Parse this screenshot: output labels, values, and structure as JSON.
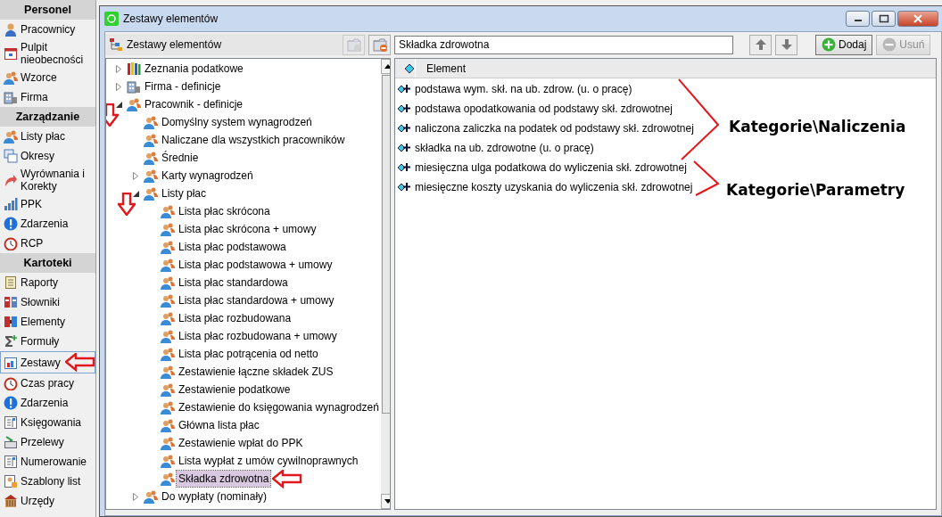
{
  "sidebar": {
    "sections": [
      {
        "title": "Personel",
        "items": [
          {
            "label": "Pracownicy",
            "selected": false
          },
          {
            "label": "Pulpit nieobecności",
            "selected": false
          },
          {
            "label": "Wzorce",
            "selected": false
          },
          {
            "label": "Firma",
            "selected": false
          }
        ]
      },
      {
        "title": "Zarządzanie",
        "items": [
          {
            "label": "Listy płac",
            "selected": false
          },
          {
            "label": "Okresy",
            "selected": false
          },
          {
            "label": "Wyrównania i Korekty",
            "selected": false
          },
          {
            "label": "PPK",
            "selected": false
          },
          {
            "label": "Zdarzenia",
            "selected": false
          },
          {
            "label": "RCP",
            "selected": false
          }
        ]
      },
      {
        "title": "Kartoteki",
        "items": [
          {
            "label": "Raporty",
            "selected": false
          },
          {
            "label": "Słowniki",
            "selected": false
          },
          {
            "label": "Elementy",
            "selected": false
          },
          {
            "label": "Formuły",
            "selected": false
          },
          {
            "label": "Zestawy",
            "selected": true,
            "arrow": true
          },
          {
            "label": "Czas pracy",
            "selected": false
          },
          {
            "label": "Zdarzenia",
            "selected": false
          },
          {
            "label": "Księgowania",
            "selected": false
          },
          {
            "label": "Przelewy",
            "selected": false
          },
          {
            "label": "Numerowanie",
            "selected": false
          },
          {
            "label": "Szablony list",
            "selected": false
          },
          {
            "label": "Urzędy",
            "selected": false
          }
        ]
      }
    ]
  },
  "window": {
    "title": "Zestawy elementów"
  },
  "tree": {
    "title": "Zestawy elementów",
    "items": [
      {
        "label": "Zeznania podatkowe",
        "kind": "books",
        "expanded": false,
        "selected": false
      },
      {
        "label": "Firma - definicje",
        "kind": "building",
        "expanded": false,
        "selected": false
      },
      {
        "label": "Pracownik - definicje",
        "kind": "people",
        "expanded": true,
        "selected": false,
        "arrow": true,
        "children": [
          {
            "label": "Domyślny system wynagrodzeń",
            "kind": "people",
            "selected": false
          },
          {
            "label": "Naliczane dla wszystkich pracowników",
            "kind": "people",
            "selected": false
          },
          {
            "label": "Średnie",
            "kind": "people",
            "selected": false
          },
          {
            "label": "Karty wynagrodzeń",
            "kind": "people",
            "expanded": false,
            "selected": false
          },
          {
            "label": "Listy płac",
            "kind": "people",
            "expanded": true,
            "selected": false,
            "arrow": true,
            "children": [
              {
                "label": "Lista płac skrócona",
                "kind": "people",
                "selected": false
              },
              {
                "label": "Lista płac skrócona + umowy",
                "kind": "people",
                "selected": false
              },
              {
                "label": "Lista płac podstawowa",
                "kind": "people",
                "selected": false
              },
              {
                "label": "Lista płac podstawowa + umowy",
                "kind": "people",
                "selected": false
              },
              {
                "label": "Lista płac standardowa",
                "kind": "people",
                "selected": false
              },
              {
                "label": "Lista płac standardowa + umowy",
                "kind": "people",
                "selected": false
              },
              {
                "label": "Lista płac rozbudowana",
                "kind": "people",
                "selected": false
              },
              {
                "label": "Lista płac rozbudowana + umowy",
                "kind": "people",
                "selected": false
              },
              {
                "label": "Lista płac potrącenia od netto",
                "kind": "people",
                "selected": false
              },
              {
                "label": "Zestawienie łączne składek ZUS",
                "kind": "people",
                "selected": false
              },
              {
                "label": "Zestawienie podatkowe",
                "kind": "people",
                "selected": false
              },
              {
                "label": "Zestawienie do księgowania wynagrodzeń",
                "kind": "people",
                "selected": false
              },
              {
                "label": "Główna lista płac",
                "kind": "people",
                "selected": false
              },
              {
                "label": "Zestawienie wpłat do PPK",
                "kind": "people",
                "selected": false
              },
              {
                "label": "Lista wypłat z umów cywilnoprawnych",
                "kind": "people",
                "selected": false
              },
              {
                "label": "Składka zdrowotna",
                "kind": "people",
                "selected": true,
                "arrow": true
              }
            ]
          },
          {
            "label": "Do wypłaty (nominały)",
            "kind": "people",
            "expanded": false,
            "selected": false
          }
        ]
      }
    ]
  },
  "editor": {
    "name_value": "Składka zdrowotna",
    "buttons": [
      {
        "label": "Dodaj",
        "disabled": false
      },
      {
        "label": "Usuń",
        "disabled": true
      }
    ],
    "column": "Element",
    "rows": [
      "podstawa wym. skł. na ub. zdrow. (u. o pracę)",
      "podstawa opodatkowania od podstawy skł. zdrowotnej",
      "naliczona zaliczka na podatek od podstawy skł. zdrowotnej",
      "składka na ub. zdrowotne (u. o pracę)",
      "miesięczna ulga podatkowa do wyliczenia skł. zdrowotnej",
      "miesięczne koszty uzyskania do wyliczenia skł. zdrowotnej"
    ],
    "callouts": [
      "Kategorie\\Naliczenia",
      "Kategorie\\Parametry"
    ]
  }
}
